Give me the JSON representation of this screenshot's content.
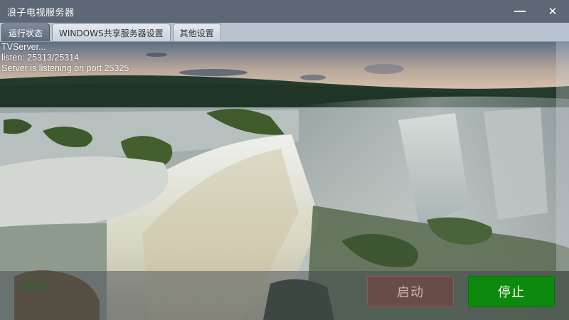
{
  "window": {
    "title": "浪子电视服务器",
    "minimize_label": "—",
    "close_label": "✕"
  },
  "tabs": [
    {
      "label": "运行状态",
      "active": true
    },
    {
      "label": "WINDOWS共享服务器设置",
      "active": false
    },
    {
      "label": "其他设置",
      "active": false
    }
  ],
  "log": {
    "lines": [
      "TVServer...",
      "listen: 25313/25314",
      "Server is listening on port 25325"
    ]
  },
  "buttons": {
    "start_label": "启动",
    "stop_label": "停止"
  },
  "colors": {
    "titlebar": "#5e6776",
    "stop_button": "#0d8a0d",
    "start_button": "#783c3e"
  },
  "icons": [
    "minimize-icon",
    "close-icon"
  ]
}
